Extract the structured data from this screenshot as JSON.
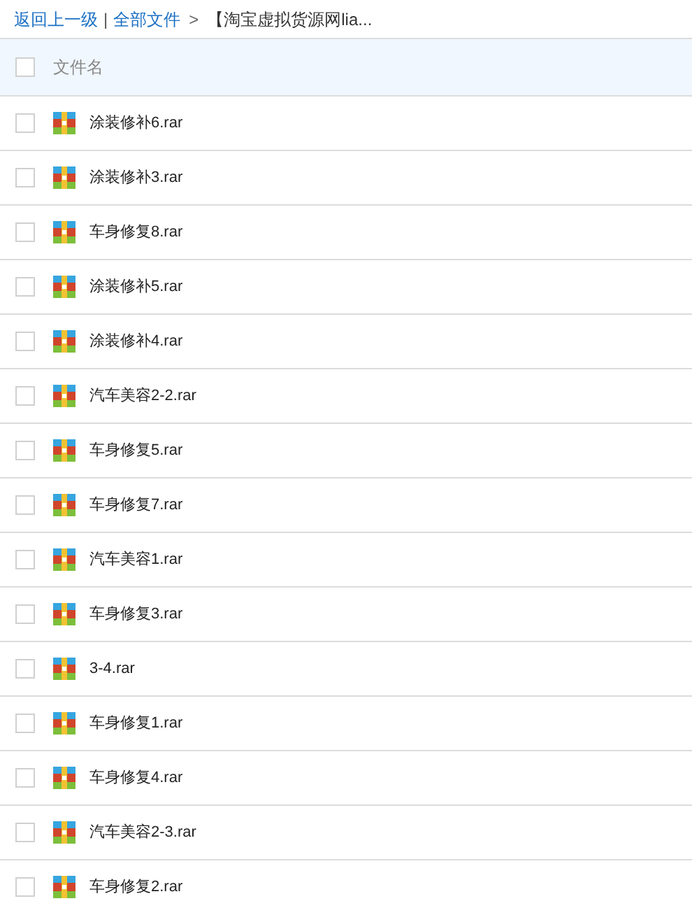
{
  "breadcrumb": {
    "back": "返回上一级",
    "separator": "|",
    "root": "全部文件",
    "arrow": ">",
    "current": "【淘宝虚拟货源网lia..."
  },
  "header": {
    "checked": false,
    "label": "文件名"
  },
  "files": [
    {
      "name": "涂装修补6.rar",
      "checked": false
    },
    {
      "name": "涂装修补3.rar",
      "checked": false
    },
    {
      "name": "车身修复8.rar",
      "checked": false
    },
    {
      "name": "涂装修补5.rar",
      "checked": false
    },
    {
      "name": "涂装修补4.rar",
      "checked": false
    },
    {
      "name": "汽车美容2-2.rar",
      "checked": false
    },
    {
      "name": "车身修复5.rar",
      "checked": false
    },
    {
      "name": "车身修复7.rar",
      "checked": false
    },
    {
      "name": "汽车美容1.rar",
      "checked": false
    },
    {
      "name": "车身修复3.rar",
      "checked": false
    },
    {
      "name": "3-4.rar",
      "checked": false
    },
    {
      "name": "车身修复1.rar",
      "checked": false
    },
    {
      "name": "车身修复4.rar",
      "checked": false
    },
    {
      "name": "汽车美容2-3.rar",
      "checked": false
    },
    {
      "name": "车身修复2.rar",
      "checked": false
    }
  ]
}
